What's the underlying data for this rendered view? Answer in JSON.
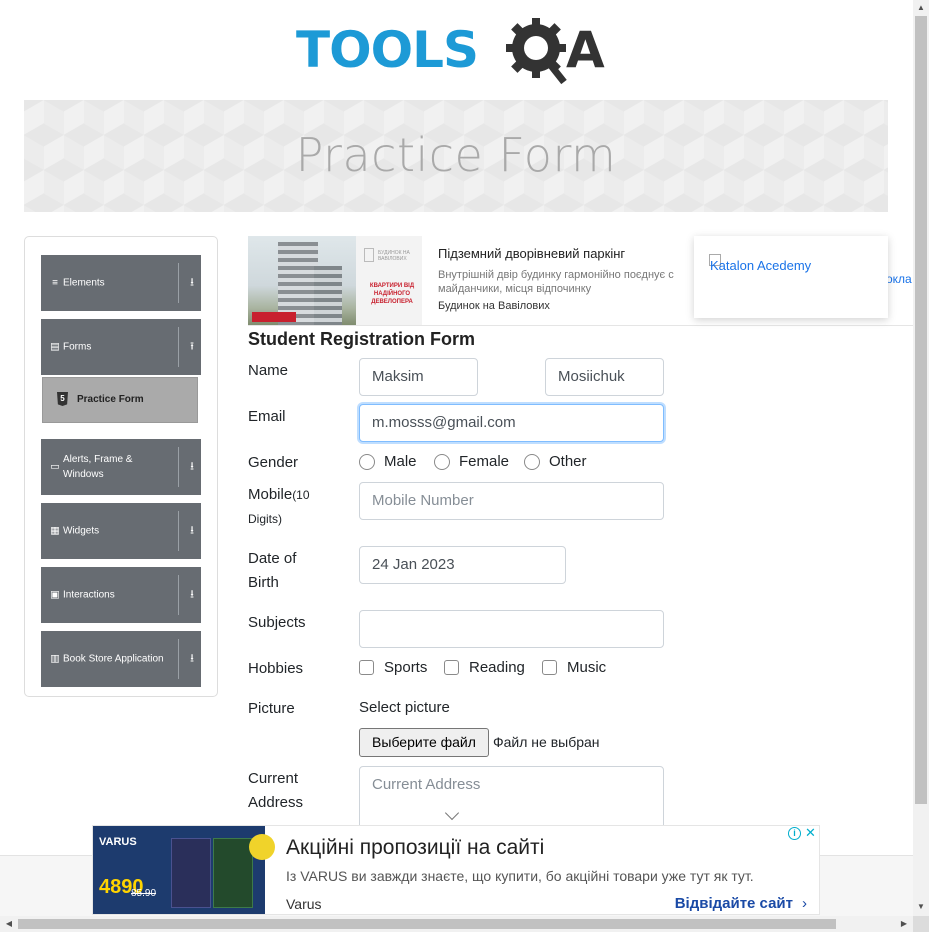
{
  "logo": {
    "part1": "TOOLS",
    "part2": "A"
  },
  "banner": {
    "title": "Practice Form"
  },
  "sidebar": {
    "groups": [
      {
        "label": "Elements",
        "icon": "≡",
        "arrow": "⭳"
      },
      {
        "label": "Forms",
        "icon": "▤",
        "arrow": "⭱"
      },
      {
        "label": "Alerts, Frame & Windows",
        "icon": "▭",
        "arrow": "⭳"
      },
      {
        "label": "Widgets",
        "icon": "▦",
        "arrow": "⭳"
      },
      {
        "label": "Interactions",
        "icon": "▣",
        "arrow": "⭳"
      },
      {
        "label": "Book Store Application",
        "icon": "▥",
        "arrow": "⭳"
      }
    ],
    "active_item": {
      "label": "Practice Form",
      "icon_glyph": "5"
    }
  },
  "ad_top": {
    "title": "Підземний дворівневий паркінг",
    "description": "Внутрішній двір будинку гармонійно поєднує с майданчики, місця відпочинку",
    "source": "Будинок на Вавілових",
    "more": "окла",
    "card_small": "БУДИНОК НА ВАВІЛОВИХ",
    "card_text": "КВАРТИРИ ВІД НАДІЙНОГО ДЕВЕЛОПЕРА"
  },
  "katalon": {
    "alt_text": "Katalon Acedemy"
  },
  "form": {
    "title": "Student Registration Form",
    "name_label": "Name",
    "first_name": "Maksim",
    "last_name": "Mosiichuk",
    "email_label": "Email",
    "email_value": "m.mosss@gmail.com",
    "gender_label": "Gender",
    "gender_options": [
      "Male",
      "Female",
      "Other"
    ],
    "mobile_label": "Mobile",
    "mobile_hint": "(10 Digits)",
    "mobile_placeholder": "Mobile Number",
    "dob_label": "Date of Birth",
    "dob_value": "24 Jan 2023",
    "subjects_label": "Subjects",
    "hobbies_label": "Hobbies",
    "hobby_options": [
      "Sports",
      "Reading",
      "Music"
    ],
    "picture_label": "Picture",
    "select_picture": "Select picture",
    "file_button": "Выберите файл",
    "file_status": "Файл не выбран",
    "address_label": "Current Address",
    "address_placeholder": "Current Address"
  },
  "ad_bottom": {
    "title": "Акційні пропозиції на сайті",
    "description": "Із VARUS ви завжди знаєте, що купити, бо акційні товари уже тут як тут.",
    "brand": "Varus",
    "cta": "Відвідайте сайт",
    "img_logo": "VARUS",
    "img_price": "4890",
    "img_old_price": "85.90"
  },
  "colors": {
    "accent": "#1d9ad6",
    "sidebar_bg": "#676c72",
    "active_bg": "#aaaaaa"
  }
}
